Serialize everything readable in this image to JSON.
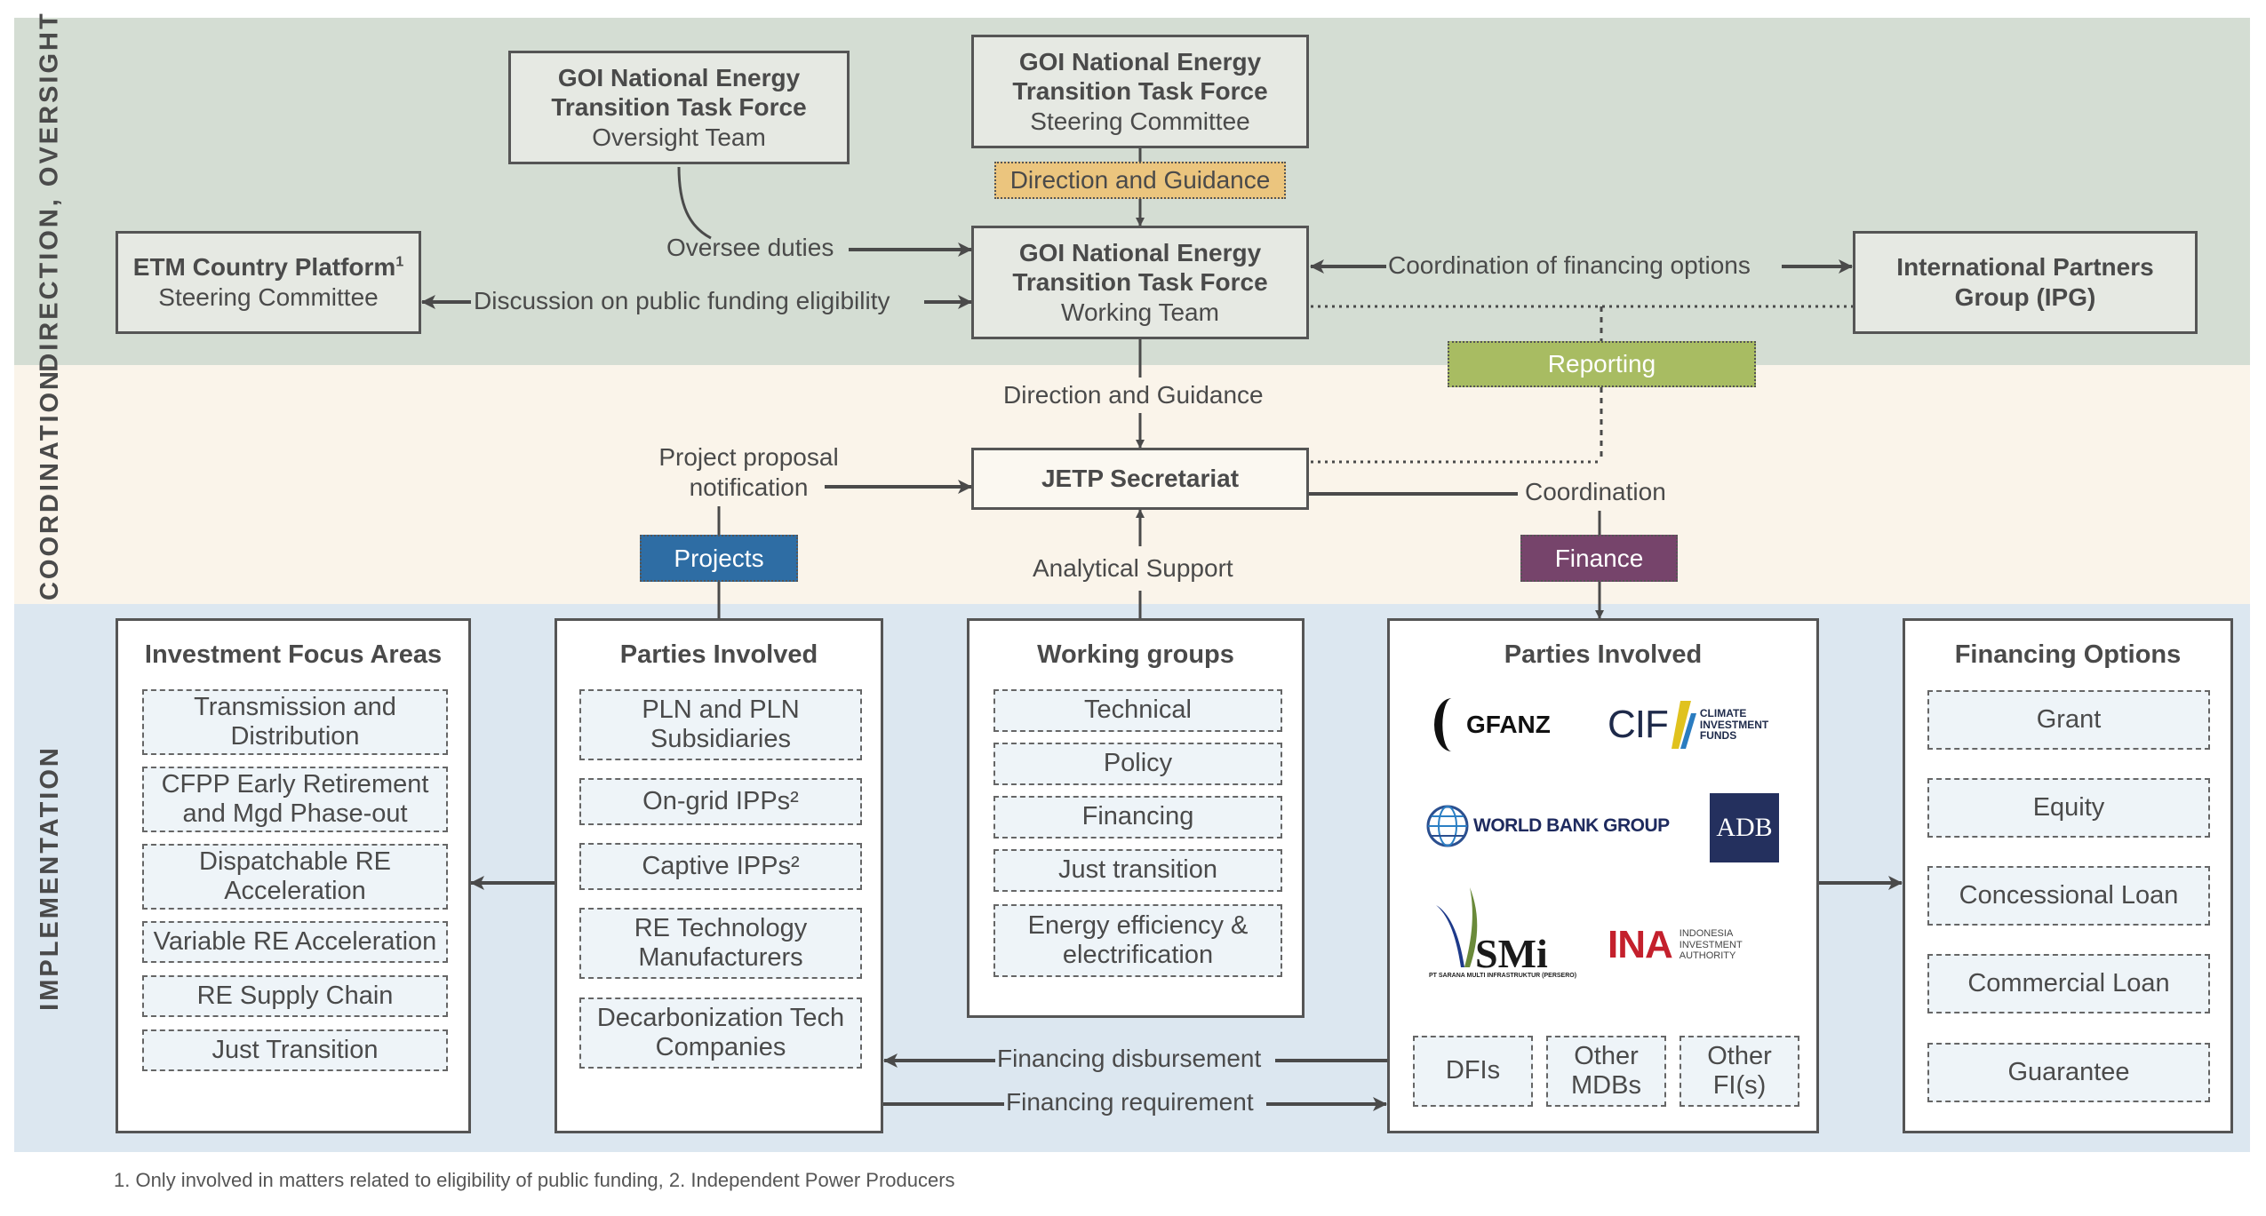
{
  "sections": {
    "direction": "DIRECTION, OVERSIGHT",
    "coordination": "COORDINATION",
    "implementation": "IMPLEMENTATION"
  },
  "boxes": {
    "oversight": {
      "title": "GOI National Energy Transition Task Force",
      "title_l1": "GOI National Energy",
      "title_l2": "Transition Task Force",
      "sub": "Oversight Team"
    },
    "steering": {
      "title_l1": "GOI National Energy",
      "title_l2": "Transition Task Force",
      "sub": "Steering Committee"
    },
    "working": {
      "title_l1": "GOI National Energy",
      "title_l2": "Transition Task Force",
      "sub": "Working Team"
    },
    "etm": {
      "title": "ETM Country Platform",
      "sup": "1",
      "sub": "Steering Committee"
    },
    "ipg": {
      "title_l1": "International Partners",
      "title_l2": "Group (IPG)"
    },
    "jetp": {
      "title": "JETP Secretariat"
    }
  },
  "tags": {
    "direction_guidance": {
      "label": "Direction and Guidance",
      "color": "#ebc57e"
    },
    "reporting": {
      "label": "Reporting",
      "color": "#a8bc62"
    },
    "projects": {
      "label": "Projects",
      "color": "#2e6da4"
    },
    "finance": {
      "label": "Finance",
      "color": "#76446b"
    }
  },
  "connectors": {
    "oversee_duties": "Oversee duties",
    "discussion": "Discussion on public funding eligibility",
    "coordination_financing": "Coordination of financing options",
    "direction_guidance_2": "Direction and Guidance",
    "project_proposal_l1": "Project proposal",
    "project_proposal_l2": "notification",
    "coordination": "Coordination",
    "analytical_support": "Analytical Support",
    "financing_disbursement": "Financing disbursement",
    "financing_requirement": "Financing requirement"
  },
  "panels": {
    "investment_focus": {
      "title": "Investment Focus Areas",
      "items": [
        "Transmission and Distribution",
        "CFPP Early Retirement and Mgd Phase-out",
        "Dispatchable RE Acceleration",
        "Variable RE Acceleration",
        "RE Supply Chain",
        "Just Transition"
      ]
    },
    "parties_projects": {
      "title": "Parties Involved",
      "items": [
        "PLN and PLN Subsidiaries",
        "On-grid IPPs²",
        "Captive IPPs²",
        "RE Technology Manufacturers",
        "Decarbonization Tech Companies"
      ]
    },
    "working_groups": {
      "title": "Working groups",
      "items": [
        "Technical",
        "Policy",
        "Financing",
        "Just transition",
        "Energy efficiency & electrification"
      ]
    },
    "parties_finance": {
      "title": "Parties Involved",
      "logos": [
        "GFANZ",
        "CIF",
        "CLIMATE INVESTMENT FUNDS",
        "WORLD BANK GROUP",
        "ADB",
        "SMi",
        "PT SARANA MULTI INFRASTRUKTUR (PERSERO)",
        "INA",
        "INDONESIA INVESTMENT AUTHORITY"
      ],
      "items": [
        "DFIs",
        "Other MDBs",
        "Other FI(s)"
      ]
    },
    "financing_options": {
      "title": "Financing Options",
      "items": [
        "Grant",
        "Equity",
        "Concessional Loan",
        "Commercial Loan",
        "Guarantee"
      ]
    }
  },
  "logos": {
    "gfanz": "GFANZ",
    "cif": "CIF",
    "cif_l1": "CLIMATE",
    "cif_l2": "INVESTMENT",
    "cif_l3": "FUNDS",
    "wbg": "WORLD BANK GROUP",
    "adb": "ADB",
    "smi": "SMi",
    "smi_sub": "PT SARANA MULTI INFRASTRUKTUR (PERSERO)",
    "ina": "INA",
    "ina_l1": "INDONESIA",
    "ina_l2": "INVESTMENT",
    "ina_l3": "AUTHORITY"
  },
  "footnote": "1. Only involved in matters related to eligibility of public funding, 2. Independent Power Producers"
}
